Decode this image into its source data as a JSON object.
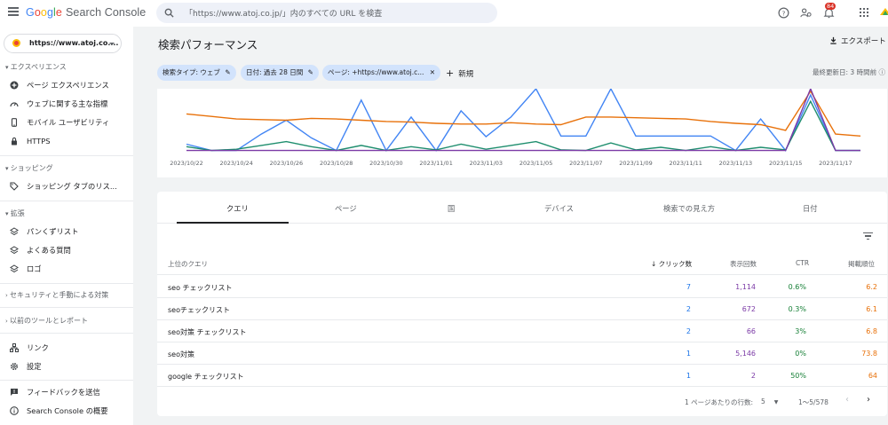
{
  "app": {
    "logo_google": [
      "G",
      "o",
      "o",
      "g",
      "l",
      "e"
    ],
    "logo_product": "Search Console",
    "search_placeholder": "「https://www.atoj.co.jp/」内のすべての URL を検査",
    "notification_count": "84"
  },
  "sidebar": {
    "property": "https://www.atoj.co....",
    "sections": [
      {
        "label": "エクスペリエンス",
        "items": [
          {
            "label": "ページ エクスペリエンス",
            "icon": "plus-circle-icon"
          },
          {
            "label": "ウェブに関する主な指標",
            "icon": "speedometer-icon"
          },
          {
            "label": "モバイル ユーザビリティ",
            "icon": "phone-icon"
          },
          {
            "label": "HTTPS",
            "icon": "lock-icon"
          }
        ]
      },
      {
        "label": "ショッピング",
        "items": [
          {
            "label": "ショッピング タブのリス...",
            "icon": "tag-icon"
          }
        ]
      },
      {
        "label": "拡張",
        "items": [
          {
            "label": "パンくずリスト",
            "icon": "layers-icon"
          },
          {
            "label": "よくある質問",
            "icon": "layers-icon"
          },
          {
            "label": "ロゴ",
            "icon": "layers-icon"
          }
        ]
      }
    ],
    "collapsed_sections": [
      "セキュリティと手動による対策",
      "以前のツールとレポート"
    ],
    "bottom_items": [
      {
        "label": "リンク",
        "icon": "links-icon"
      },
      {
        "label": "設定",
        "icon": "gear-icon"
      }
    ],
    "footer_items": [
      {
        "label": "フィードバックを送信",
        "icon": "feedback-icon"
      },
      {
        "label": "Search Console の概要",
        "icon": "info-icon"
      }
    ]
  },
  "main": {
    "title": "検索パフォーマンス",
    "export_label": "エクスポート",
    "filters": [
      {
        "label": "検索タイプ: ウェブ",
        "action": "edit"
      },
      {
        "label": "日付: 過去 28 日間",
        "action": "edit"
      },
      {
        "label": "ページ: +https://www.atoj.c...",
        "action": "close"
      }
    ],
    "new_filter": "新規",
    "last_updated": "最終更新日: 3 時間前"
  },
  "chart_data": {
    "type": "line",
    "x": [
      "2023/10/22",
      "2023/10/23",
      "2023/10/24",
      "2023/10/25",
      "2023/10/26",
      "2023/10/27",
      "2023/10/28",
      "2023/10/29",
      "2023/10/30",
      "2023/10/31",
      "2023/11/01",
      "2023/11/02",
      "2023/11/03",
      "2023/11/04",
      "2023/11/05",
      "2023/11/06",
      "2023/11/07",
      "2023/11/08",
      "2023/11/09",
      "2023/11/10",
      "2023/11/11",
      "2023/11/12",
      "2023/11/13",
      "2023/11/14",
      "2023/11/15",
      "2023/11/16",
      "2023/11/17",
      "2023/11/18"
    ],
    "tick_labels": [
      "2023/10/22",
      "2023/10/24",
      "2023/10/26",
      "2023/10/28",
      "2023/10/30",
      "2023/11/01",
      "2023/11/03",
      "2023/11/05",
      "2023/11/07",
      "2023/11/09",
      "2023/11/11",
      "2023/11/13",
      "2023/11/15",
      "2023/11/17"
    ],
    "series": [
      {
        "color": "#4285f4",
        "values": [
          0.12,
          0.02,
          0.02,
          0.28,
          0.5,
          0.22,
          0.02,
          0.82,
          0.02,
          0.55,
          0.02,
          0.65,
          0.24,
          0.55,
          1.0,
          0.25,
          0.25,
          1.0,
          0.25,
          0.25,
          0.25,
          0.25,
          0.02,
          0.52,
          0.02,
          0.9,
          0.02,
          0.02
        ]
      },
      {
        "color": "#e8710a",
        "values": [
          0.6,
          0.56,
          0.52,
          0.51,
          0.5,
          0.53,
          0.52,
          0.5,
          0.48,
          0.47,
          0.45,
          0.44,
          0.44,
          0.46,
          0.44,
          0.43,
          0.55,
          0.55,
          0.54,
          0.53,
          0.52,
          0.48,
          0.45,
          0.43,
          0.34,
          0.96,
          0.28,
          0.25
        ]
      },
      {
        "color": "#1e8e6e",
        "values": [
          0.08,
          0.02,
          0.04,
          0.1,
          0.16,
          0.08,
          0.02,
          0.1,
          0.02,
          0.08,
          0.03,
          0.12,
          0.04,
          0.1,
          0.16,
          0.03,
          0.02,
          0.14,
          0.03,
          0.07,
          0.02,
          0.08,
          0.02,
          0.07,
          0.03,
          0.8,
          0.02,
          0.02
        ]
      },
      {
        "color": "#7b3aa6",
        "values": [
          0.02,
          0.02,
          0.02,
          0.02,
          0.02,
          0.02,
          0.02,
          0.02,
          0.02,
          0.02,
          0.02,
          0.02,
          0.02,
          0.02,
          0.02,
          0.02,
          0.02,
          0.02,
          0.02,
          0.02,
          0.02,
          0.02,
          0.02,
          0.02,
          0.02,
          1.0,
          0.02,
          0.02
        ]
      }
    ]
  },
  "table": {
    "tabs": [
      "クエリ",
      "ページ",
      "国",
      "デバイス",
      "検索での見え方",
      "日付"
    ],
    "active_tab": 0,
    "headers": {
      "query": "上位のクエリ",
      "clicks": "クリック数",
      "impressions": "表示回数",
      "ctr": "CTR",
      "position": "掲載順位"
    },
    "rows": [
      {
        "query": "seo チェックリスト",
        "clicks": "7",
        "impressions": "1,114",
        "ctr": "0.6%",
        "position": "6.2"
      },
      {
        "query": "seoチェックリスト",
        "clicks": "2",
        "impressions": "672",
        "ctr": "0.3%",
        "position": "6.1"
      },
      {
        "query": "seo対策 チェックリスト",
        "clicks": "2",
        "impressions": "66",
        "ctr": "3%",
        "position": "6.8"
      },
      {
        "query": "seo対策",
        "clicks": "1",
        "impressions": "5,146",
        "ctr": "0%",
        "position": "73.8"
      },
      {
        "query": "google チェックリスト",
        "clicks": "1",
        "impressions": "2",
        "ctr": "50%",
        "position": "64"
      }
    ],
    "pager": {
      "rows_label": "1 ページあたりの行数:",
      "rows_value": "5",
      "range": "1〜5/578"
    }
  }
}
